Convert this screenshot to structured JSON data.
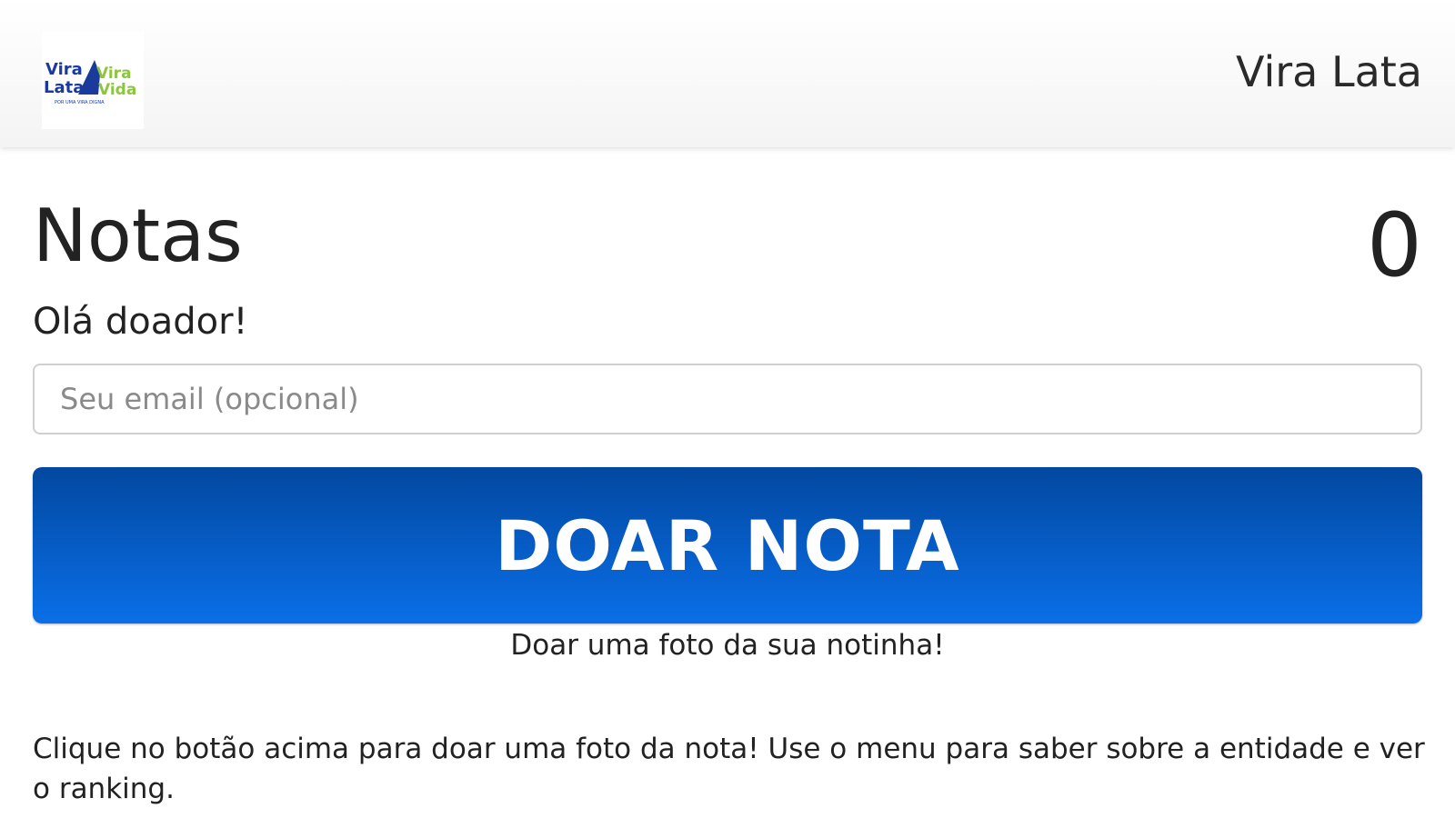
{
  "header": {
    "brand_label": "Vira Lata",
    "logo": {
      "name": "vira-lata-vira-vida-logo",
      "line1": "Vira",
      "line2": "Lata",
      "line3": "Vira",
      "line4": "Vida",
      "tagline": "POR UMA VIRA DIGNA",
      "colors": {
        "blue": "#1a3a9c",
        "green": "#8cc63f"
      }
    }
  },
  "main": {
    "title": "Notas",
    "count": "0",
    "greeting": "Olá doador!",
    "email_placeholder": "Seu email (opcional)",
    "email_value": "",
    "donate_button_label": "DOAR NOTA",
    "donate_caption": "Doar uma foto da sua notinha!",
    "instructions": "Clique no botão acima para doar uma foto da nota! Use o menu para saber sobre a entidade e ver o ranking."
  },
  "colors": {
    "button_top": "#0248a0",
    "button_bottom": "#0a6fe8",
    "text": "#222222"
  }
}
